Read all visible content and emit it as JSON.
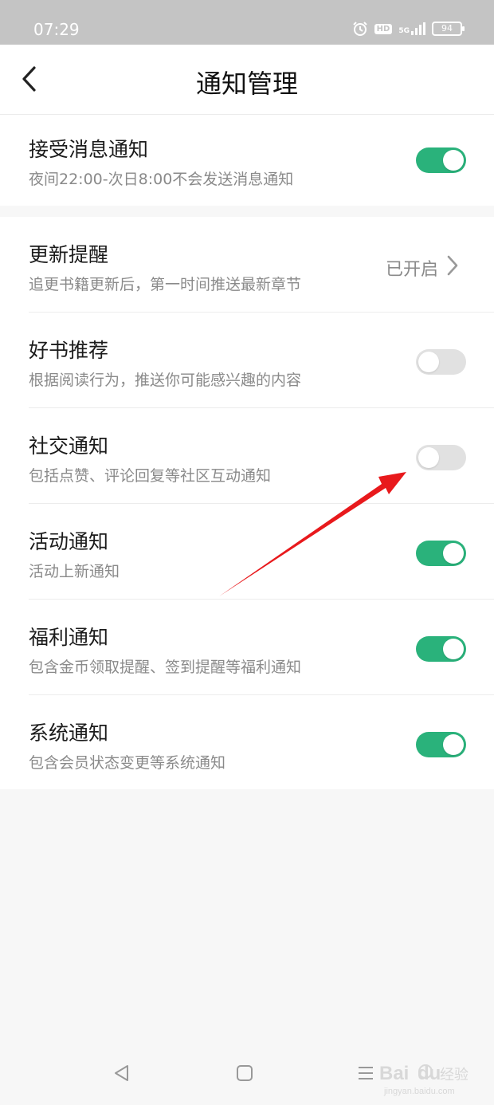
{
  "status_bar": {
    "time": "07:29",
    "icons": [
      "alarm-icon",
      "hd-icon",
      "signal-icon",
      "battery-icon"
    ],
    "hd_label": "HD",
    "network_label": "5G",
    "battery_level": "94"
  },
  "header": {
    "title": "通知管理",
    "back_icon": "chevron-left-icon"
  },
  "master": {
    "title": "接受消息通知",
    "subtitle": "夜间22:00-次日8:00不会发送消息通知",
    "enabled": true
  },
  "settings": [
    {
      "title": "更新提醒",
      "subtitle": "追更书籍更新后，第一时间推送最新章节",
      "type": "link",
      "value": "已开启"
    },
    {
      "title": "好书推荐",
      "subtitle": "根据阅读行为，推送你可能感兴趣的内容",
      "type": "toggle",
      "enabled": false
    },
    {
      "title": "社交通知",
      "subtitle": "包括点赞、评论回复等社区互动通知",
      "type": "toggle",
      "enabled": false
    },
    {
      "title": "活动通知",
      "subtitle": "活动上新通知",
      "type": "toggle",
      "enabled": true
    },
    {
      "title": "福利通知",
      "subtitle": "包含金币领取提醒、签到提醒等福利通知",
      "type": "toggle",
      "enabled": true
    },
    {
      "title": "系统通知",
      "subtitle": "包含会员状态变更等系统通知",
      "type": "toggle",
      "enabled": true
    }
  ],
  "nav_bar": {
    "icons": [
      "back-triangle-icon",
      "home-square-icon",
      "menu-lines-icon"
    ]
  },
  "watermark": {
    "brand": "Bai",
    "brand_tail": "du",
    "suffix": "经验",
    "url": "jingyan.baidu.com"
  },
  "colors": {
    "toggle_on": "#2ab27b",
    "toggle_off": "#e1e1e1",
    "annotation_arrow": "#e8191c",
    "status_bar_bg": "#c4c4c4"
  }
}
